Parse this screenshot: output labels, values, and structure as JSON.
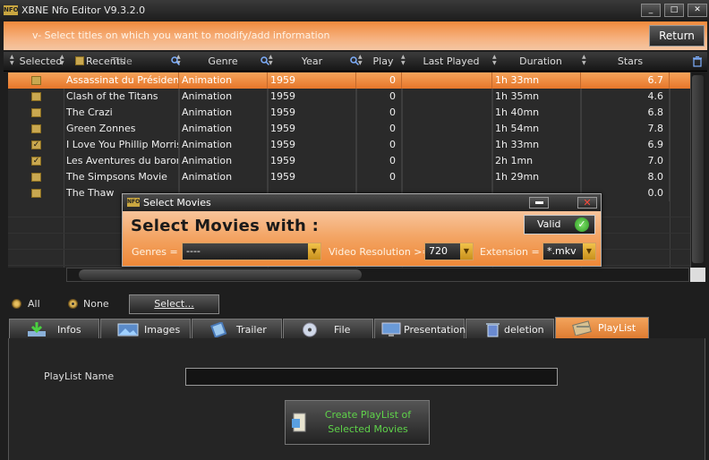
{
  "window": {
    "logo_text": "NFO",
    "title": "XBNE Nfo Editor V9.3.2.0",
    "min_label": "_",
    "max_label": "□",
    "close_label": "✕"
  },
  "instruction": "v- Select titles on which you want to modify/add information",
  "return_label": "Return",
  "columns": {
    "selected": "Selected",
    "recents": "Recents",
    "title": "Title",
    "genre": "Genre",
    "year": "Year",
    "play": "Play",
    "last_played": "Last Played",
    "duration": "Duration",
    "stars": "Stars"
  },
  "rows": [
    {
      "checked": "",
      "title": "Assassinat du Président",
      "genre": "Animation",
      "year": "1959",
      "play": "0",
      "last_played": "",
      "duration": "1h 33mn",
      "stars": "6.7"
    },
    {
      "checked": "",
      "title": "Clash of the Titans",
      "genre": "Animation",
      "year": "1959",
      "play": "0",
      "last_played": "",
      "duration": "1h 35mn",
      "stars": "4.6"
    },
    {
      "checked": "",
      "title": "The Crazi",
      "genre": "Animation",
      "year": "1959",
      "play": "0",
      "last_played": "",
      "duration": "1h 40mn",
      "stars": "6.8"
    },
    {
      "checked": "",
      "title": "Green Zonnes",
      "genre": "Animation",
      "year": "1959",
      "play": "0",
      "last_played": "",
      "duration": "1h 54mn",
      "stars": "7.8"
    },
    {
      "checked": "✓",
      "title": "I Love You Phillip Morris",
      "genre": "Animation",
      "year": "1959",
      "play": "0",
      "last_played": "",
      "duration": "1h 33mn",
      "stars": "6.9"
    },
    {
      "checked": "✓",
      "title": "Les Aventures du baron de Münchhausen",
      "genre": "Animation",
      "year": "1959",
      "play": "0",
      "last_played": "",
      "duration": "2h 1mn",
      "stars": "7.0"
    },
    {
      "checked": "",
      "title": "The Simpsons Movie",
      "genre": "Animation",
      "year": "1959",
      "play": "0",
      "last_played": "",
      "duration": "1h 29mn",
      "stars": "8.0"
    },
    {
      "checked": "",
      "title": "The Thaw",
      "genre": "",
      "year": "",
      "play": "",
      "last_played": "",
      "duration": "",
      "stars": "0.0"
    }
  ],
  "selection": {
    "all_label": "All",
    "none_label": "None",
    "select_button": "Select..."
  },
  "tabs": [
    {
      "label": "Infos",
      "icon": "download-icon"
    },
    {
      "label": "Images",
      "icon": "images-icon"
    },
    {
      "label": "Trailer",
      "icon": "film-icon"
    },
    {
      "label": "File",
      "icon": "disc-icon"
    },
    {
      "label": "Presentation",
      "icon": "monitor-icon"
    },
    {
      "label": "deletion",
      "icon": "trash-icon"
    },
    {
      "label": "PlayList",
      "icon": "playlist-icon"
    }
  ],
  "playlist": {
    "name_label": "PlayList Name",
    "name_value": "",
    "create_line1": "Create PlayList of",
    "create_line2": "Selected Movies"
  },
  "dialog": {
    "logo_text": "NFO",
    "title": "Select Movies",
    "heading": "Select Movies with :",
    "valid_label": "Valid",
    "genres_label": "Genres =",
    "genres_value": "----",
    "resolution_label": "Video Resolution >=",
    "resolution_value": "720",
    "extension_label": "Extension =",
    "extension_value": "*.mkv"
  },
  "colors": {
    "accent_orange": "#ef8a3a",
    "valid_green": "#3cb82a",
    "create_text_green": "#5fd34a"
  }
}
